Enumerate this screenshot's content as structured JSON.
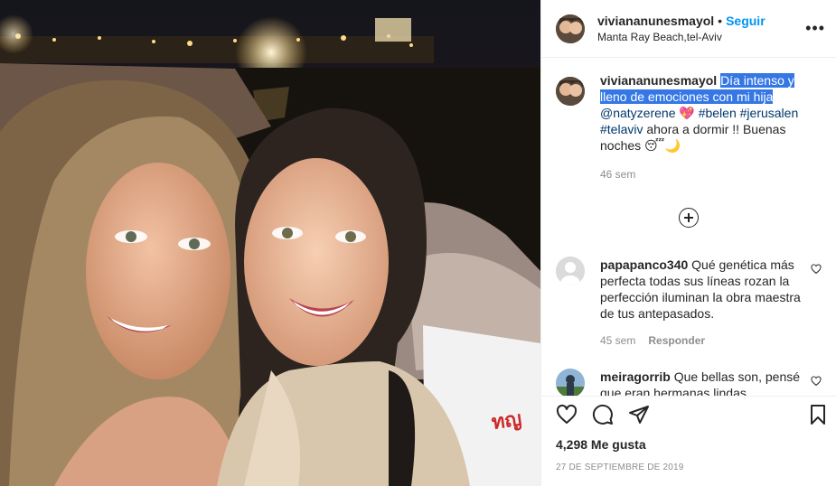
{
  "header": {
    "username": "viviananunesmayol",
    "separator": "•",
    "follow_label": "Seguir",
    "location": "Manta Ray Beach,tel-Aviv",
    "more_label": "•••"
  },
  "caption": {
    "username": "viviananunesmayol",
    "highlighted": "Día intenso y lleno de emociones con mi hija",
    "mention": "@natyzerene",
    "emoji_heart": "💖",
    "tag_belen": "#belen",
    "tag_jerusalen": "#jerusalen",
    "tag_telaviv": "#telaviv",
    "rest": "ahora a dormir !! Buenas noches",
    "emoji_end": "😴🌙",
    "age": "46 sem"
  },
  "comments": [
    {
      "username": "papapanco340",
      "text": "Qué genética más perfecta todas sus líneas rozan la perfección iluminan la obra maestra de tus antepasados.",
      "age": "45 sem",
      "reply_label": "Responder"
    },
    {
      "username": "meiragorrib",
      "text": "Que bellas son, pensé que eran hermanas lindas"
    }
  ],
  "footer": {
    "likes": "4,298 Me gusta",
    "date": "27 DE SEPTIEMBRE DE 2019"
  },
  "colors": {
    "accent": "#0095f6",
    "selection": "#3578e5",
    "border": "#efefef",
    "muted": "#8e8e8e"
  },
  "icons": [
    "heart-icon",
    "comment-icon",
    "share-icon",
    "bookmark-icon",
    "add-comment-icon"
  ]
}
